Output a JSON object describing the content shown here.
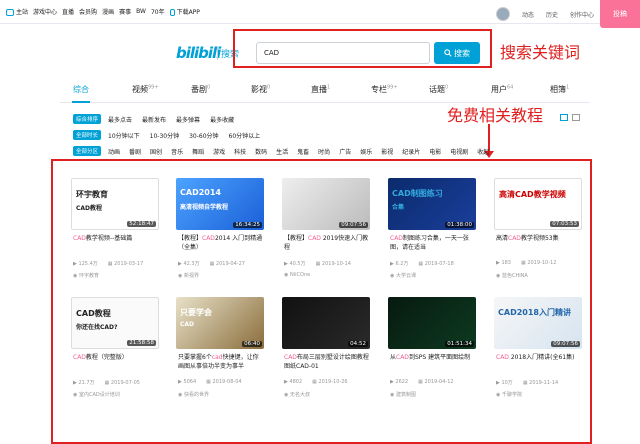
{
  "topbar": {
    "left": [
      "主站",
      "游戏中心",
      "直播",
      "会员购",
      "漫画",
      "赛事",
      "BW",
      "70年",
      "下载APP"
    ],
    "right": [
      "动态",
      "历史",
      "创作中心"
    ],
    "upload": "投稿"
  },
  "logo": {
    "text": "bilibili",
    "sub": "搜索"
  },
  "search": {
    "value": "CAD",
    "button": "搜索"
  },
  "annotations": {
    "keyword": "搜索关键词",
    "free": "免费相关教程"
  },
  "tabs": [
    {
      "label": "综合",
      "count": ""
    },
    {
      "label": "视频",
      "count": "99+"
    },
    {
      "label": "番剧",
      "count": "0"
    },
    {
      "label": "影视",
      "count": "0"
    },
    {
      "label": "直播",
      "count": "1"
    },
    {
      "label": "专栏",
      "count": "99+"
    },
    {
      "label": "话题",
      "count": "0"
    },
    {
      "label": "用户",
      "count": "64"
    },
    {
      "label": "相簿",
      "count": "1"
    }
  ],
  "filters": {
    "sort": {
      "chip": "综合排序",
      "options": [
        "最多点击",
        "最新发布",
        "最多弹幕",
        "最多收藏"
      ]
    },
    "duration": {
      "chip": "全部时长",
      "options": [
        "10分钟以下",
        "10-30分钟",
        "30-60分钟",
        "60分钟以上"
      ]
    },
    "zone": {
      "chip": "全部分区",
      "options": [
        "动画",
        "番剧",
        "国创",
        "音乐",
        "舞蹈",
        "游戏",
        "科技",
        "数码",
        "生活",
        "鬼畜",
        "时尚",
        "广告",
        "娱乐",
        "影视",
        "纪录片",
        "电影",
        "电视剧",
        "收起"
      ]
    }
  },
  "accent_color": "#00a1d6",
  "annotation_color": "#e02020",
  "videos": [
    {
      "thumb_title": "环宇教育",
      "thumb_sub": "CAD教程",
      "duration": "52:18:47",
      "title_hl": "CAD",
      "title": "教学视频--基础篇",
      "plays": "125.4万",
      "date": "2019-03-17",
      "author": "环宇教育"
    },
    {
      "thumb_title": "CAD2014",
      "thumb_sub": "高清视频自学教程",
      "duration": "16:34:25",
      "title_pre": "【教程】",
      "title_hl": "CAD",
      "title": "2014 入门到精通（全集）",
      "plays": "42.3万",
      "date": "2019-04-27",
      "author": "新视界"
    },
    {
      "thumb_title": "",
      "thumb_sub": "",
      "duration": "09:07:56",
      "title_pre": "【教程】",
      "title_hl": "CAD",
      "title": " 2019快速入门教程",
      "plays": "40.5万",
      "date": "2019-10-14",
      "author": "NiiCOne"
    },
    {
      "thumb_title": "CAD制图练习",
      "thumb_sub": "合集",
      "duration": "01:38:00",
      "title_hl": "CAD",
      "title": "制图练习合集，一天一张图，请在适当",
      "plays": "6.2万",
      "date": "2019-07-18",
      "author": "大学云课"
    },
    {
      "thumb_title": "高清CAD教学视频",
      "thumb_sub": "",
      "duration": "07:03:53",
      "title_pre": "高清",
      "title_hl": "CAD",
      "title": "教学视频53集",
      "plays": "183",
      "date": "2019-10-12",
      "author": "蓝色CHINA"
    },
    {
      "thumb_title": "CAD教程",
      "thumb_sub": "你还在找CAD?",
      "duration": "21:58:58",
      "title_hl": "CAD",
      "title": "教程（完整版）",
      "plays": "21.7万",
      "date": "2019-07-05",
      "author": "室内CAD设计培训"
    },
    {
      "thumb_title": "只要学会",
      "thumb_sub": "CAD",
      "duration": "06:40",
      "title_pre": "只要掌握6个",
      "title_hl": "cad",
      "title": "快捷键，让你画图从事倍功半变为事半",
      "plays": "5064",
      "date": "2019-08-04",
      "author": "快看的世界"
    },
    {
      "thumb_title": "",
      "thumb_sub": "",
      "duration": "04:52",
      "title_hl": "CAD",
      "title": "布局三层别墅设计绘图教程图纸CAD-01",
      "plays": "4802",
      "date": "2019-10-26",
      "author": "无名大叔"
    },
    {
      "thumb_title": "",
      "thumb_sub": "",
      "duration": "01:51:34",
      "title_pre": "从",
      "title_hl": "CAD",
      "title": "到SPS 建筑平面图绘制",
      "plays": "2622",
      "date": "2019-04-12",
      "author": "建筑制图"
    },
    {
      "thumb_title": "CAD2018入门精讲",
      "thumb_sub": "",
      "duration": "09:07:56",
      "title_hl": "CAD",
      "title": " 2018入门精讲(全61集)",
      "plays": "10万",
      "date": "2019-11-14",
      "author": "千聊学院"
    }
  ]
}
